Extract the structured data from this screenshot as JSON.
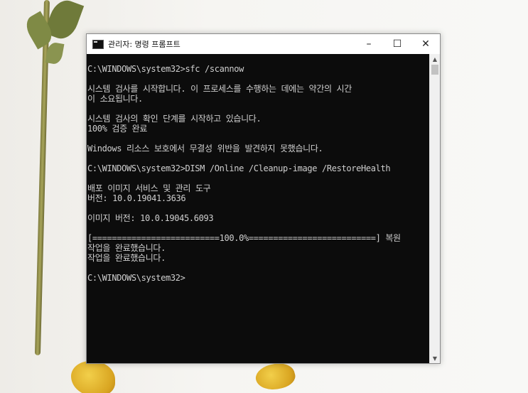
{
  "window": {
    "title": "관리자: 명령 프롬프트",
    "controls": {
      "minimize": "–",
      "maximize": "☐",
      "close": "✕"
    }
  },
  "console": {
    "lines": [
      "C:\\WINDOWS\\system32>sfc /scannow",
      "",
      "시스템 검사를 시작합니다. 이 프로세스를 수행하는 데에는 약간의 시간",
      "이 소요됩니다.",
      "",
      "시스템 검사의 확인 단계를 시작하고 있습니다.",
      "100% 검증 완료",
      "",
      "Windows 리소스 보호에서 무결성 위반을 발견하지 못했습니다.",
      "",
      "C:\\WINDOWS\\system32>DISM /Online /Cleanup-image /RestoreHealth",
      "",
      "배포 이미지 서비스 및 관리 도구",
      "버전: 10.0.19041.3636",
      "",
      "이미지 버전: 10.0.19045.6093",
      "",
      "[==========================100.0%==========================] 복원",
      "작업을 완료했습니다.",
      "작업을 완료했습니다.",
      "",
      "C:\\WINDOWS\\system32>"
    ]
  },
  "scrollbar": {
    "up": "▲",
    "down": "▼"
  },
  "icons": [
    "cmd-app-icon",
    "minimize-icon",
    "maximize-icon",
    "close-icon",
    "scroll-up-icon",
    "scroll-down-icon"
  ]
}
